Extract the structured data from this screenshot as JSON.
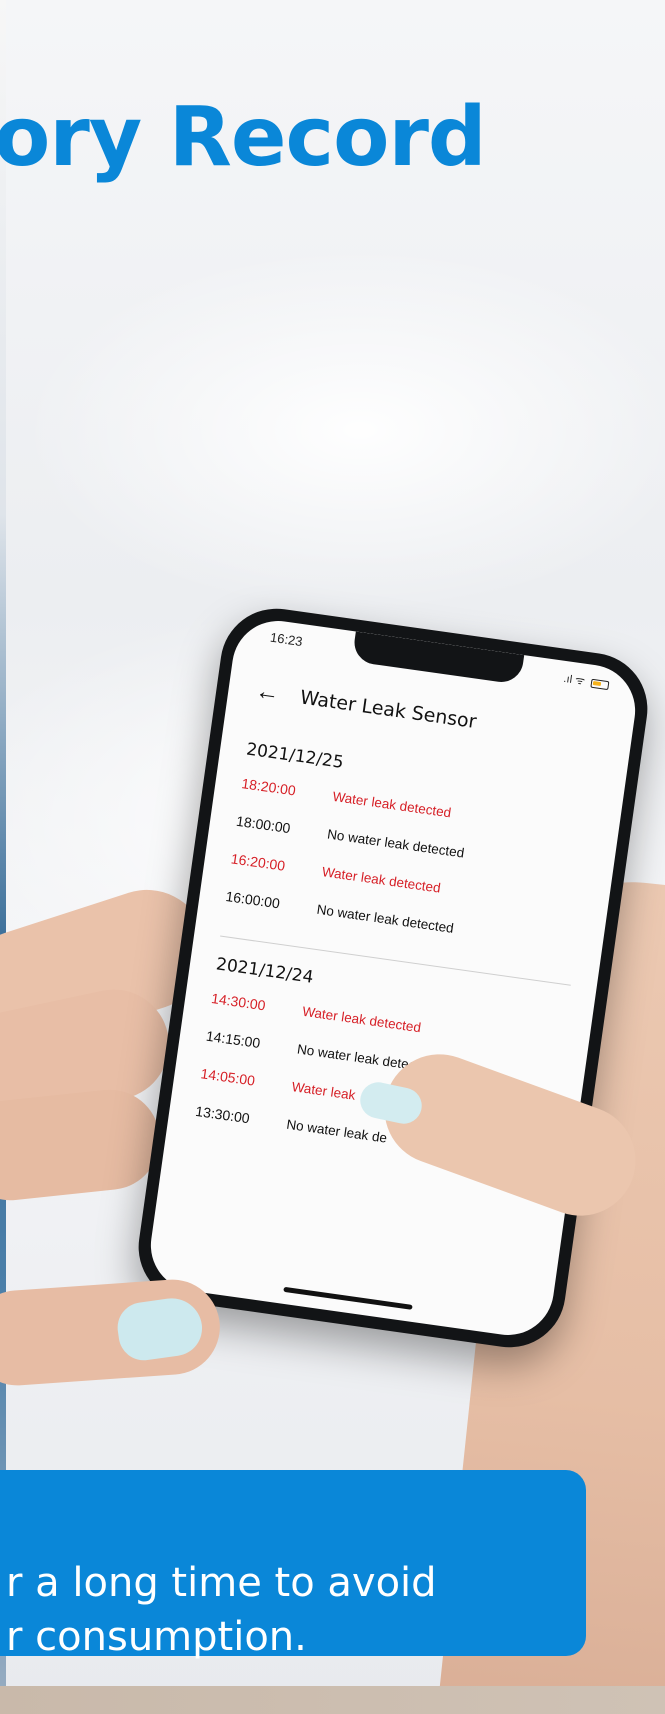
{
  "headline": "ory Record",
  "phone": {
    "status_time": "16:23",
    "status_signal": ".ıl ᯤ",
    "title": "Water Leak Sensor",
    "back_icon": "arrow-left-icon",
    "days": [
      {
        "date": "2021/12/25",
        "records": [
          {
            "time": "18:20:00",
            "status": "Water leak detected",
            "alert": true
          },
          {
            "time": "18:00:00",
            "status": "No water leak detected",
            "alert": false
          },
          {
            "time": "16:20:00",
            "status": "Water leak detected",
            "alert": true
          },
          {
            "time": "16:00:00",
            "status": "No water leak detected",
            "alert": false
          }
        ]
      },
      {
        "date": "2021/12/24",
        "records": [
          {
            "time": "14:30:00",
            "status": "Water leak detected",
            "alert": true
          },
          {
            "time": "14:15:00",
            "status": "No water leak detected",
            "alert": false
          },
          {
            "time": "14:05:00",
            "status": "Water leak",
            "alert": true
          },
          {
            "time": "13:30:00",
            "status": "No water leak de",
            "alert": false
          }
        ]
      }
    ]
  },
  "banner": {
    "line1": "r a long time to avoid",
    "line2": "r consumption."
  },
  "colors": {
    "brand_blue": "#0a87d8",
    "alert_red": "#d61f26"
  }
}
